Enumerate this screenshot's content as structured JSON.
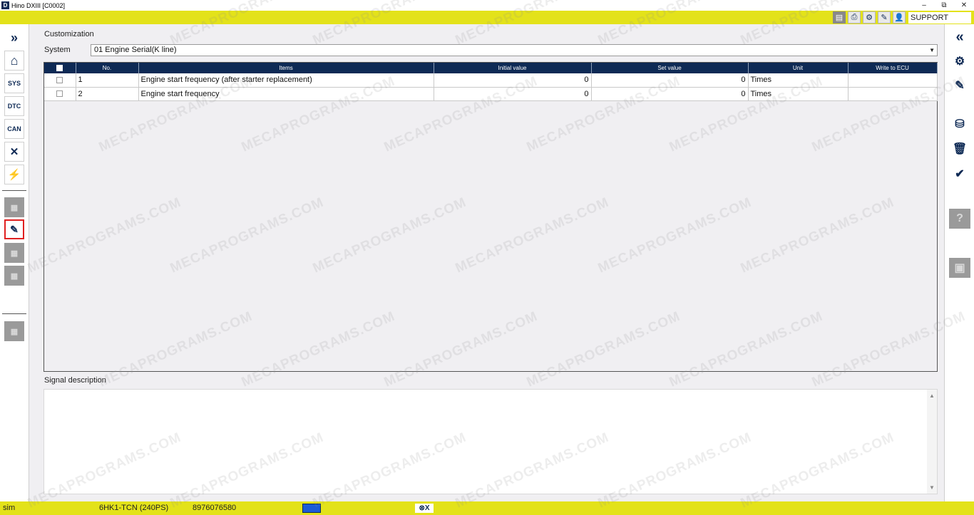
{
  "window": {
    "app_icon": "D",
    "title": "Hino DXIII [C0002]",
    "minimize": "–",
    "maximize": "⧉",
    "close": "✕"
  },
  "toolbar": {
    "user": "SUPPORT",
    "icons": [
      "report-icon",
      "print-icon",
      "gear-icon",
      "edit-icon",
      "user-icon"
    ]
  },
  "page": {
    "title": "Customization",
    "system_label": "System",
    "system_value": "01  Engine  Serial(K line)",
    "signal_label": "Signal description"
  },
  "left_nav": [
    "forward-icon",
    "home-icon",
    "sys-icon",
    "dtc-icon",
    "can-icon",
    "tools-icon",
    "monitor-icon",
    "disabled-1",
    "customization-icon",
    "disabled-2",
    "disabled-3",
    "disabled-4"
  ],
  "right_nav": [
    "back-icon",
    "engine-check-icon",
    "edit-sheet-icon",
    "save-disk-icon",
    "trash-icon",
    "write-icon",
    "help-icon",
    "lock-icon"
  ],
  "table": {
    "columns": [
      "",
      "No.",
      "Items",
      "Initial value",
      "Set value",
      "Unit",
      "Write to ECU"
    ],
    "rows": [
      {
        "no": "1",
        "item": "Engine start frequency (after starter replacement)",
        "initial": "0",
        "set": "0",
        "unit": "Times",
        "write": ""
      },
      {
        "no": "2",
        "item": "Engine start frequency",
        "initial": "0",
        "set": "0",
        "unit": "Times",
        "write": ""
      }
    ]
  },
  "status": {
    "mode": "sim",
    "engine": "6HK1-TCN (240PS)",
    "vin": "8976076580",
    "conn": "⊗X"
  },
  "watermark": "MECAPROGRAMS.COM",
  "colors": {
    "accent_yellow": "#e3e21a",
    "header_navy": "#0e2a55"
  }
}
